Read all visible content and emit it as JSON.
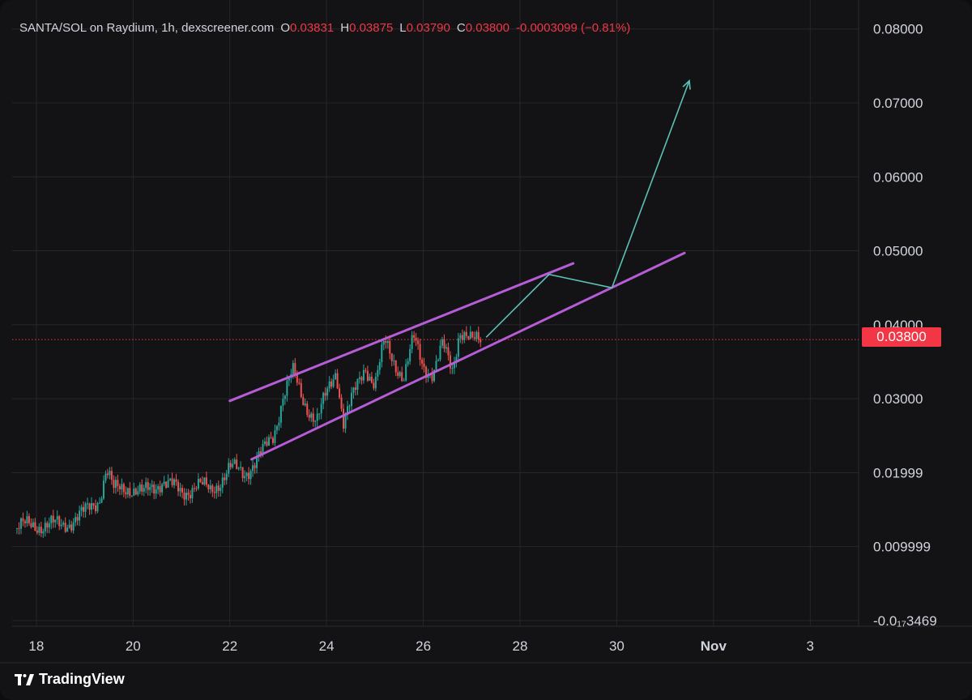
{
  "header": {
    "symbol": "SANTA/SOL on Raydium, 1h, dexscreener.com",
    "open_label": "O",
    "open_value": "0.03831",
    "high_label": "H",
    "high_value": "0.03875",
    "low_label": "L",
    "low_value": "0.03790",
    "close_label": "C",
    "close_value": "0.03800",
    "change": "-0.0003099 (−0.81%)"
  },
  "price_tag": "0.03800",
  "brand": {
    "name": "TradingView",
    "icon": "tradingview-logo-icon"
  },
  "colors": {
    "background": "#131316",
    "grid": "#26262b",
    "bull": "#26a69a",
    "bear": "#ef5350",
    "channel": "#b65dd6",
    "projection": "#5bc0b5",
    "price_line": "#f23645",
    "axis_text": "#d1d4dc"
  },
  "chart_data": {
    "type": "candlestick",
    "title": "SANTA/SOL on Raydium, 1h, dexscreener.com",
    "xlabel": "",
    "ylabel": "",
    "x_ticks": [
      "18",
      "20",
      "22",
      "24",
      "26",
      "28",
      "30",
      "Nov",
      "3"
    ],
    "x_tick_values": [
      18,
      20,
      22,
      24,
      26,
      28,
      30,
      32,
      34
    ],
    "x_unit": "October day",
    "y_ticks": [
      "0.08000",
      "0.07000",
      "0.06000",
      "0.05000",
      "0.04000",
      "0.03000",
      "0.01999",
      "0.009999",
      "-0.0₁₇3469"
    ],
    "y_tick_values": [
      0.08,
      0.07,
      0.06,
      0.05,
      0.04,
      0.03,
      0.01999,
      0.009999,
      -3.469e-19
    ],
    "xlim": [
      17.5,
      35
    ],
    "ylim": [
      -0.00045,
      0.0826
    ],
    "grid": true,
    "last_price": 0.038,
    "price_path": [
      [
        17.6,
        0.0125
      ],
      [
        18.0,
        0.013
      ],
      [
        18.5,
        0.0128
      ],
      [
        19.0,
        0.0145
      ],
      [
        19.3,
        0.0165
      ],
      [
        19.45,
        0.0205
      ],
      [
        19.6,
        0.0175
      ],
      [
        19.9,
        0.0182
      ],
      [
        20.2,
        0.017
      ],
      [
        20.6,
        0.019
      ],
      [
        21.0,
        0.0172
      ],
      [
        21.3,
        0.0184
      ],
      [
        21.6,
        0.0175
      ],
      [
        21.8,
        0.019
      ],
      [
        22.0,
        0.0205
      ],
      [
        22.3,
        0.02
      ],
      [
        22.45,
        0.021
      ],
      [
        22.7,
        0.0228
      ],
      [
        22.9,
        0.025
      ],
      [
        23.1,
        0.0305
      ],
      [
        23.3,
        0.0335
      ],
      [
        23.5,
        0.03
      ],
      [
        23.8,
        0.027
      ],
      [
        24.0,
        0.0305
      ],
      [
        24.2,
        0.034
      ],
      [
        24.35,
        0.027
      ],
      [
        24.6,
        0.031
      ],
      [
        24.8,
        0.0345
      ],
      [
        25.0,
        0.032
      ],
      [
        25.2,
        0.0375
      ],
      [
        25.4,
        0.035
      ],
      [
        25.6,
        0.033
      ],
      [
        25.8,
        0.038
      ],
      [
        26.0,
        0.0345
      ],
      [
        26.2,
        0.0335
      ],
      [
        26.4,
        0.037
      ],
      [
        26.6,
        0.034
      ],
      [
        26.75,
        0.0395
      ],
      [
        27.0,
        0.0375
      ],
      [
        27.2,
        0.038
      ]
    ],
    "channel_upper": [
      [
        22.0,
        0.0297
      ],
      [
        29.1,
        0.0483
      ]
    ],
    "channel_lower": [
      [
        22.45,
        0.0218
      ],
      [
        31.4,
        0.0497
      ]
    ],
    "projection": [
      [
        27.3,
        0.0383
      ],
      [
        28.6,
        0.0468
      ],
      [
        29.9,
        0.045
      ],
      [
        31.5,
        0.073
      ]
    ]
  }
}
